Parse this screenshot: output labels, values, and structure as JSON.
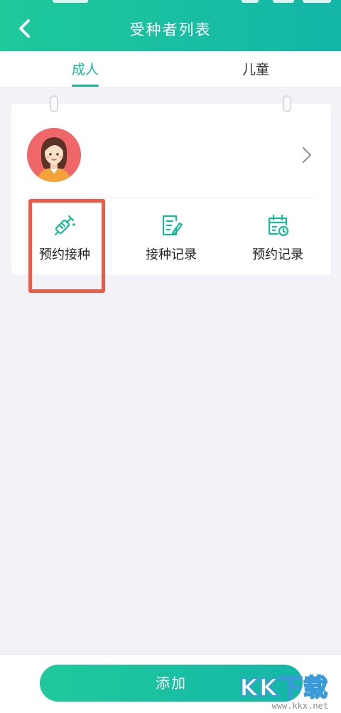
{
  "header": {
    "title": "受种者列表",
    "back_icon": "chevron-left-icon"
  },
  "tabs": [
    {
      "label": "成人",
      "active": true
    },
    {
      "label": "儿童",
      "active": false
    }
  ],
  "person_card": {
    "avatar_icon": "female-avatar",
    "chevron_icon": "chevron-right-icon",
    "actions": [
      {
        "label": "预约接种",
        "icon": "syringe-icon",
        "highlighted": true
      },
      {
        "label": "接种记录",
        "icon": "record-edit-icon",
        "highlighted": false
      },
      {
        "label": "预约记录",
        "icon": "calendar-clock-icon",
        "highlighted": false
      }
    ]
  },
  "footer": {
    "add_label": "添加"
  },
  "watermark": {
    "logo": "KK下载",
    "url": "www.kkx.net"
  },
  "colors": {
    "brand_green": "#19b99a",
    "highlight_red": "#ee5a48",
    "avatar_bg": "#f0676a"
  }
}
